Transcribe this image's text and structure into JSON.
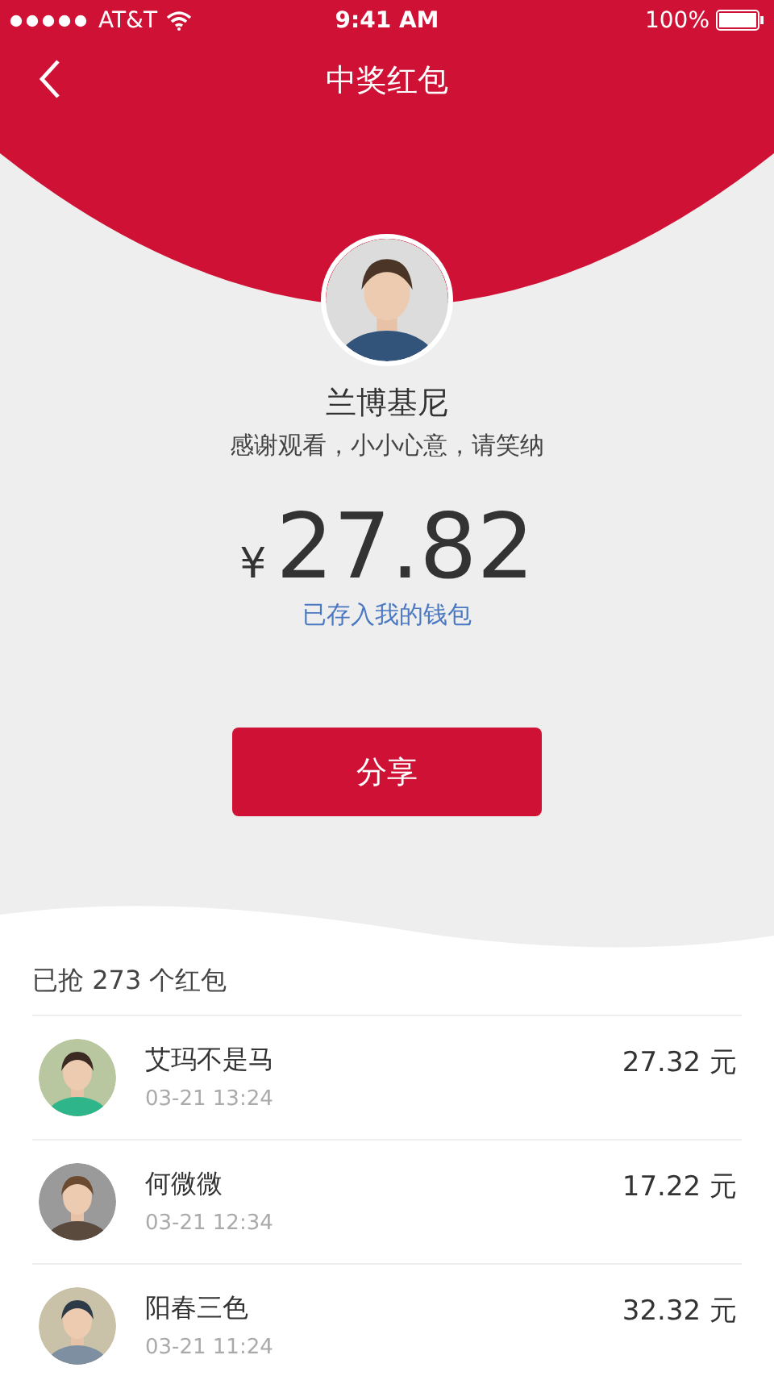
{
  "status_bar": {
    "carrier": "AT&T",
    "time": "9:41 AM",
    "battery": "100%"
  },
  "nav": {
    "title": "中奖红包"
  },
  "sender": {
    "name": "兰博基尼",
    "message": "感谢观看，小小心意，请笑纳"
  },
  "amount": {
    "currency": "¥",
    "value": "27.82",
    "note": "已存入我的钱包"
  },
  "share_button": "分享",
  "list": {
    "header": "已抢 273 个红包",
    "rows": [
      {
        "name": "艾玛不是马",
        "time": "03-21 13:24",
        "amount": "27.32 元"
      },
      {
        "name": "何微微",
        "time": "03-21 12:34",
        "amount": "17.22 元"
      },
      {
        "name": "阳春三色",
        "time": "03-21 11:24",
        "amount": "32.32 元"
      }
    ]
  }
}
